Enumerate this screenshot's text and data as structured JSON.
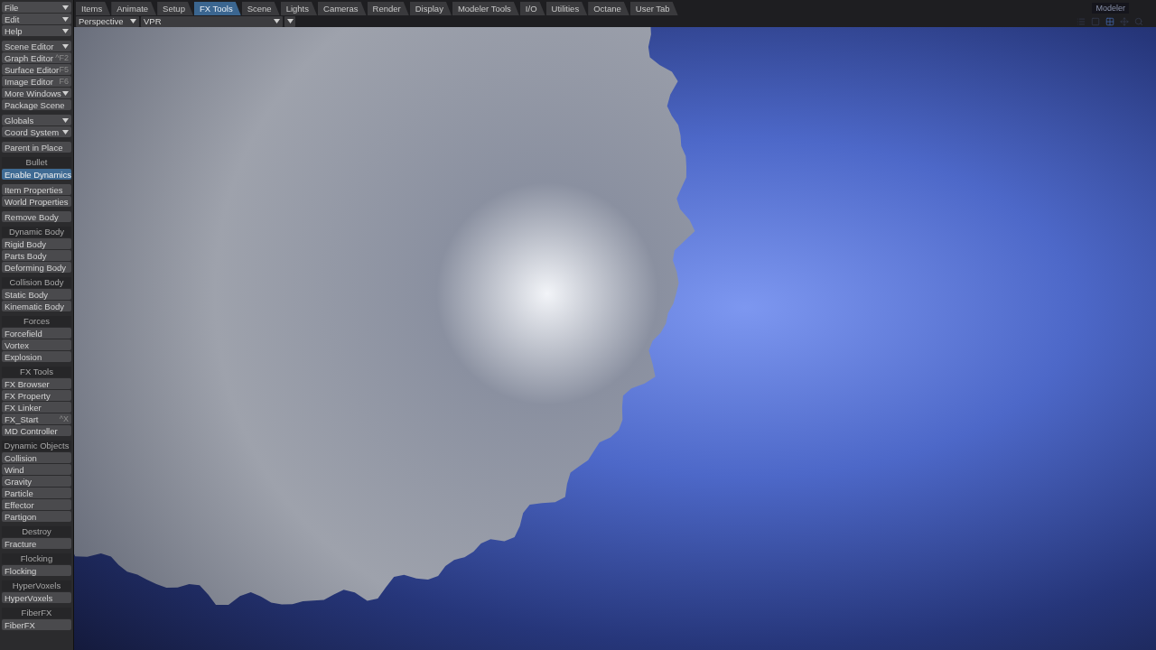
{
  "tabs": [
    {
      "label": "Items",
      "selected": false
    },
    {
      "label": "Animate",
      "selected": false
    },
    {
      "label": "Setup",
      "selected": false
    },
    {
      "label": "FX Tools",
      "selected": true
    },
    {
      "label": "Scene",
      "selected": false
    },
    {
      "label": "Lights",
      "selected": false
    },
    {
      "label": "Cameras",
      "selected": false
    },
    {
      "label": "Render",
      "selected": false
    },
    {
      "label": "Display",
      "selected": false
    },
    {
      "label": "Modeler Tools",
      "selected": false
    },
    {
      "label": "I/O",
      "selected": false
    },
    {
      "label": "Utilities",
      "selected": false
    },
    {
      "label": "Octane",
      "selected": false
    },
    {
      "label": "User Tab",
      "selected": false
    }
  ],
  "mode_switch": {
    "label": "Modeler"
  },
  "viewport_header": {
    "view": "Perspective",
    "render_mode": "VPR"
  },
  "sidebar": [
    {
      "items": [
        {
          "label": "File",
          "kind": "dropdown",
          "selected": false
        },
        {
          "label": "Edit",
          "kind": "dropdown",
          "selected": false
        },
        {
          "label": "Help",
          "kind": "dropdown",
          "selected": false
        }
      ]
    },
    {
      "items": [
        {
          "label": "Scene Editor",
          "kind": "dropdown",
          "selected": false
        },
        {
          "label": "Graph Editor",
          "kind": "button",
          "shortcut": "^F2",
          "selected": false
        },
        {
          "label": "Surface Editor",
          "kind": "button",
          "shortcut": "F5",
          "selected": false
        },
        {
          "label": "Image Editor",
          "kind": "button",
          "shortcut": "F6",
          "selected": false
        },
        {
          "label": "More Windows",
          "kind": "dropdown",
          "selected": false
        },
        {
          "label": "Package Scene",
          "kind": "button",
          "selected": false
        }
      ]
    },
    {
      "items": [
        {
          "label": "Globals",
          "kind": "dropdown",
          "selected": false
        },
        {
          "label": "Coord System",
          "kind": "dropdown",
          "selected": false
        }
      ]
    },
    {
      "items": [
        {
          "label": "Parent in Place",
          "kind": "button",
          "selected": false
        }
      ]
    },
    {
      "heading": "Bullet",
      "items": [
        {
          "label": "Enable Dynamics",
          "kind": "button",
          "selected": true
        }
      ]
    },
    {
      "items": [
        {
          "label": "Item Properties",
          "kind": "button",
          "selected": false
        },
        {
          "label": "World Properties",
          "kind": "button",
          "selected": false
        }
      ]
    },
    {
      "items": [
        {
          "label": "Remove Body",
          "kind": "button",
          "selected": false
        }
      ]
    },
    {
      "heading": "Dynamic Body",
      "items": [
        {
          "label": "Rigid Body",
          "kind": "button",
          "selected": false
        },
        {
          "label": "Parts Body",
          "kind": "button",
          "selected": false
        },
        {
          "label": "Deforming Body",
          "kind": "button",
          "selected": false
        }
      ]
    },
    {
      "heading": "Collision Body",
      "items": [
        {
          "label": "Static Body",
          "kind": "button",
          "selected": false
        },
        {
          "label": "Kinematic Body",
          "kind": "button",
          "selected": false
        }
      ]
    },
    {
      "heading": "Forces",
      "items": [
        {
          "label": "Forcefield",
          "kind": "button",
          "selected": false
        },
        {
          "label": "Vortex",
          "kind": "button",
          "selected": false
        },
        {
          "label": "Explosion",
          "kind": "button",
          "selected": false
        }
      ]
    },
    {
      "heading": "FX Tools",
      "items": [
        {
          "label": "FX Browser",
          "kind": "button",
          "selected": false
        },
        {
          "label": "FX Property",
          "kind": "button",
          "selected": false
        },
        {
          "label": "FX Linker",
          "kind": "button",
          "selected": false
        },
        {
          "label": "FX_Start",
          "kind": "button",
          "shortcut": "^X",
          "selected": false
        },
        {
          "label": "MD Controller",
          "kind": "button",
          "selected": false
        }
      ]
    },
    {
      "heading": "Dynamic Objects",
      "items": [
        {
          "label": "Collision",
          "kind": "button",
          "selected": false
        },
        {
          "label": "Wind",
          "kind": "button",
          "selected": false
        },
        {
          "label": "Gravity",
          "kind": "button",
          "selected": false
        },
        {
          "label": "Particle",
          "kind": "button",
          "selected": false
        },
        {
          "label": "Effector",
          "kind": "button",
          "selected": false
        },
        {
          "label": "Partigon",
          "kind": "button",
          "selected": false
        }
      ]
    },
    {
      "heading": "Destroy",
      "items": [
        {
          "label": "Fracture",
          "kind": "button",
          "selected": false
        }
      ]
    },
    {
      "heading": "Flocking",
      "items": [
        {
          "label": "Flocking",
          "kind": "button",
          "selected": false
        }
      ]
    },
    {
      "heading": "HyperVoxels",
      "items": [
        {
          "label": "HyperVoxels",
          "kind": "button",
          "selected": false
        }
      ]
    },
    {
      "heading": "FiberFX",
      "items": [
        {
          "label": "FiberFX",
          "kind": "button",
          "selected": false
        }
      ]
    }
  ]
}
